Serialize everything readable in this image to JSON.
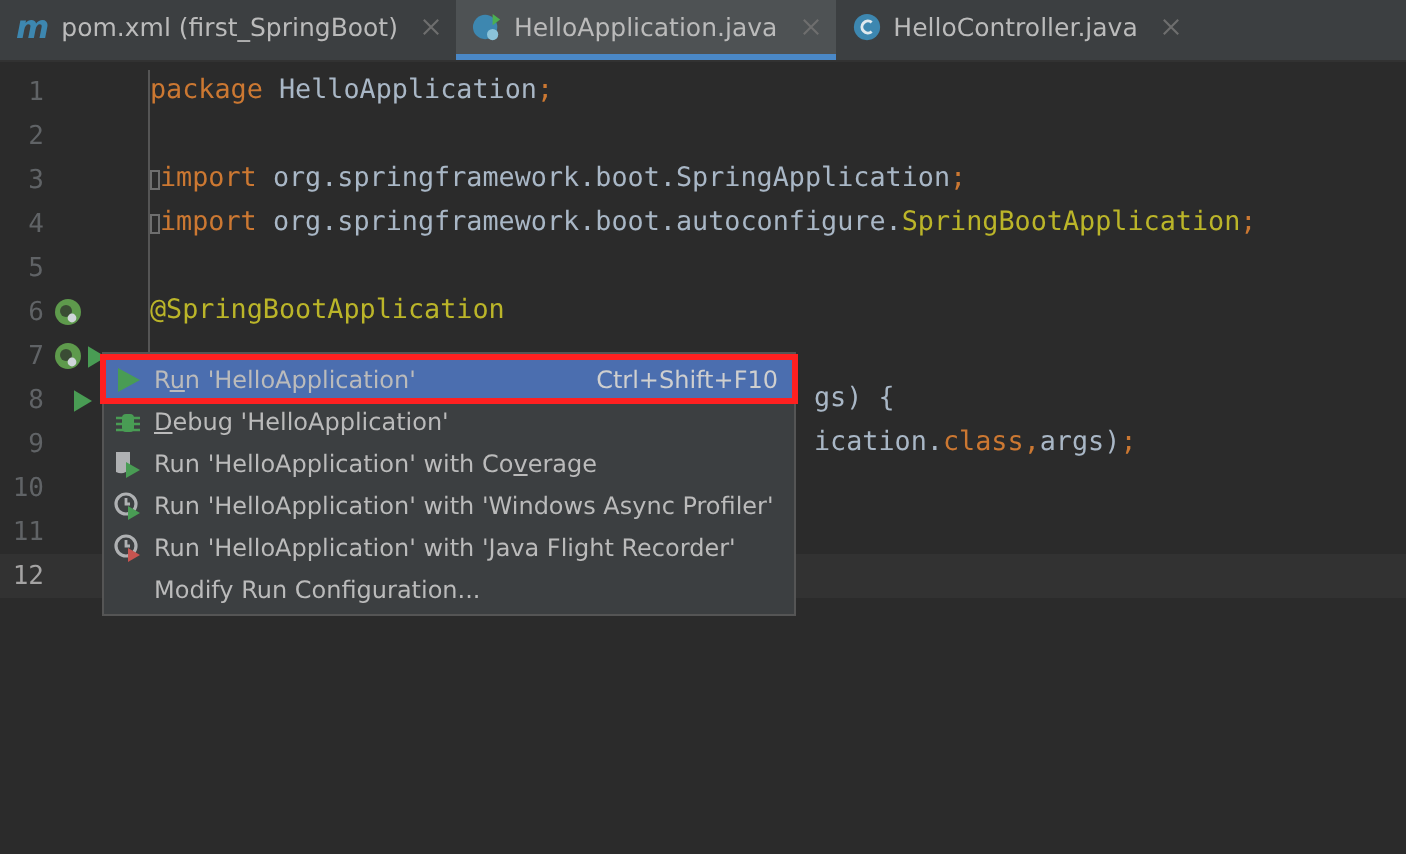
{
  "tabs": [
    {
      "glyph": "m",
      "label": "pom.xml (first_SpringBoot)",
      "selected": false
    },
    {
      "label": "HelloApplication.java",
      "selected": true
    },
    {
      "label": "HelloController.java",
      "selected": false
    }
  ],
  "lines": [
    {
      "number": "1",
      "current": false,
      "tokens": [
        {
          "kind": "keyword",
          "text": "package "
        },
        {
          "kind": "plain",
          "text": "HelloApplication"
        },
        {
          "kind": "keyword",
          "text": ";"
        }
      ]
    },
    {
      "number": "2",
      "current": false
    },
    {
      "number": "3",
      "current": false,
      "fold": true,
      "tokens": [
        {
          "kind": "keyword",
          "text": "import "
        },
        {
          "kind": "plain",
          "text": "org.springframework.boot.SpringApplication"
        },
        {
          "kind": "keyword",
          "text": ";"
        }
      ]
    },
    {
      "number": "4",
      "current": false,
      "fold": true,
      "tokens": [
        {
          "kind": "keyword",
          "text": "import "
        },
        {
          "kind": "plain",
          "text": "org.springframework.boot.autoconfigure."
        },
        {
          "kind": "annotation",
          "text": "SpringBootApplication"
        },
        {
          "kind": "keyword",
          "text": ";"
        }
      ]
    },
    {
      "number": "5",
      "current": false
    },
    {
      "number": "6",
      "current": false,
      "tokens": [
        {
          "kind": "annotation",
          "text": "@SpringBootApplication"
        }
      ]
    },
    {
      "number": "7",
      "current": false
    },
    {
      "number": "8",
      "current": false,
      "covered": true,
      "tokens": [
        {
          "kind": "plain",
          "text": "gs) {"
        }
      ]
    },
    {
      "number": "9",
      "current": false,
      "covered": true,
      "tokens": [
        {
          "kind": "plain",
          "text": "ication."
        },
        {
          "kind": "keyword",
          "text": "class"
        },
        {
          "kind": "keyword",
          "text": ","
        },
        {
          "kind": "plain",
          "text": "args)"
        },
        {
          "kind": "keyword",
          "text": ";"
        }
      ]
    },
    {
      "number": "10",
      "current": false
    },
    {
      "number": "11",
      "current": false
    },
    {
      "number": "12",
      "current": true
    }
  ],
  "menu": [
    {
      "selected": true,
      "before": "R",
      "mnemonic": "u",
      "after": "n 'HelloApplication'",
      "shortcut": "Ctrl+Shift+F10"
    },
    {
      "selected": false,
      "mnemonic": "D",
      "after": "ebug 'HelloApplication'"
    },
    {
      "selected": false,
      "before": "Run 'HelloApplication' with Co",
      "mnemonic": "v",
      "after": "erage"
    },
    {
      "selected": false,
      "before": "Run 'HelloApplication' with 'Windows Async Profiler'"
    },
    {
      "selected": false,
      "before": "Run 'HelloApplication' with 'Java Flight Recorder'"
    },
    {
      "selected": false,
      "before": "Modify Run Configuration..."
    }
  ]
}
